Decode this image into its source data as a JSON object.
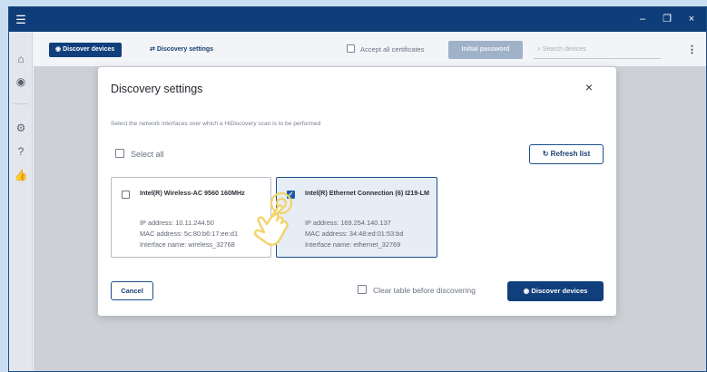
{
  "titlebar": {
    "menu_icon": "☰",
    "minimize_icon": "–",
    "restore_icon": "❐",
    "close_icon": "×"
  },
  "sidebar": {
    "items": [
      {
        "icon": "⌂",
        "name": "network-icon"
      },
      {
        "icon": "◉",
        "name": "discover-icon"
      },
      {
        "icon": "⚙",
        "name": "settings-icon"
      },
      {
        "icon": "?",
        "name": "help-icon"
      },
      {
        "icon": "👍",
        "name": "feedback-icon"
      }
    ]
  },
  "toolbar": {
    "discover_label": "Discover devices",
    "settings_label": "Discovery settings",
    "accept_certs_label": "Accept all certificates",
    "initial_password_label": "Initial password",
    "search_placeholder": "Search devices",
    "kebab_icon": "⋮"
  },
  "dialog": {
    "title": "Discovery settings",
    "close_icon": "×",
    "description": "Select the network interfaces over which a HiDiscovery scan is to be performed",
    "select_all_label": "Select all",
    "refresh_label": "Refresh list",
    "refresh_icon": "↻",
    "interfaces": [
      {
        "name": "Intel(R) Wireless-AC 9560 160MHz",
        "ip": "IP address: 10.11.244.50",
        "mac": "MAC address: 5c:80:b6:17:ee:d1",
        "iface": "Interface name: wireless_32768",
        "checked": false
      },
      {
        "name": "Intel(R) Ethernet Connection (6) I219-LM",
        "ip": "IP address: 169.254.140.137",
        "mac": "MAC address: 34:48:ed:01:53:bd",
        "iface": "Interface name: ethernet_32769",
        "checked": true
      }
    ],
    "cancel_label": "Cancel",
    "clear_table_label": "Clear table before discovering",
    "discover_label": "Discover devices",
    "discover_icon": "◉"
  },
  "colors": {
    "brand_dark": "#103f7c",
    "titlebar": "#0f3d7a",
    "selected_card_bg": "#e6edf5",
    "hand_cursor": "#f3d36b"
  }
}
